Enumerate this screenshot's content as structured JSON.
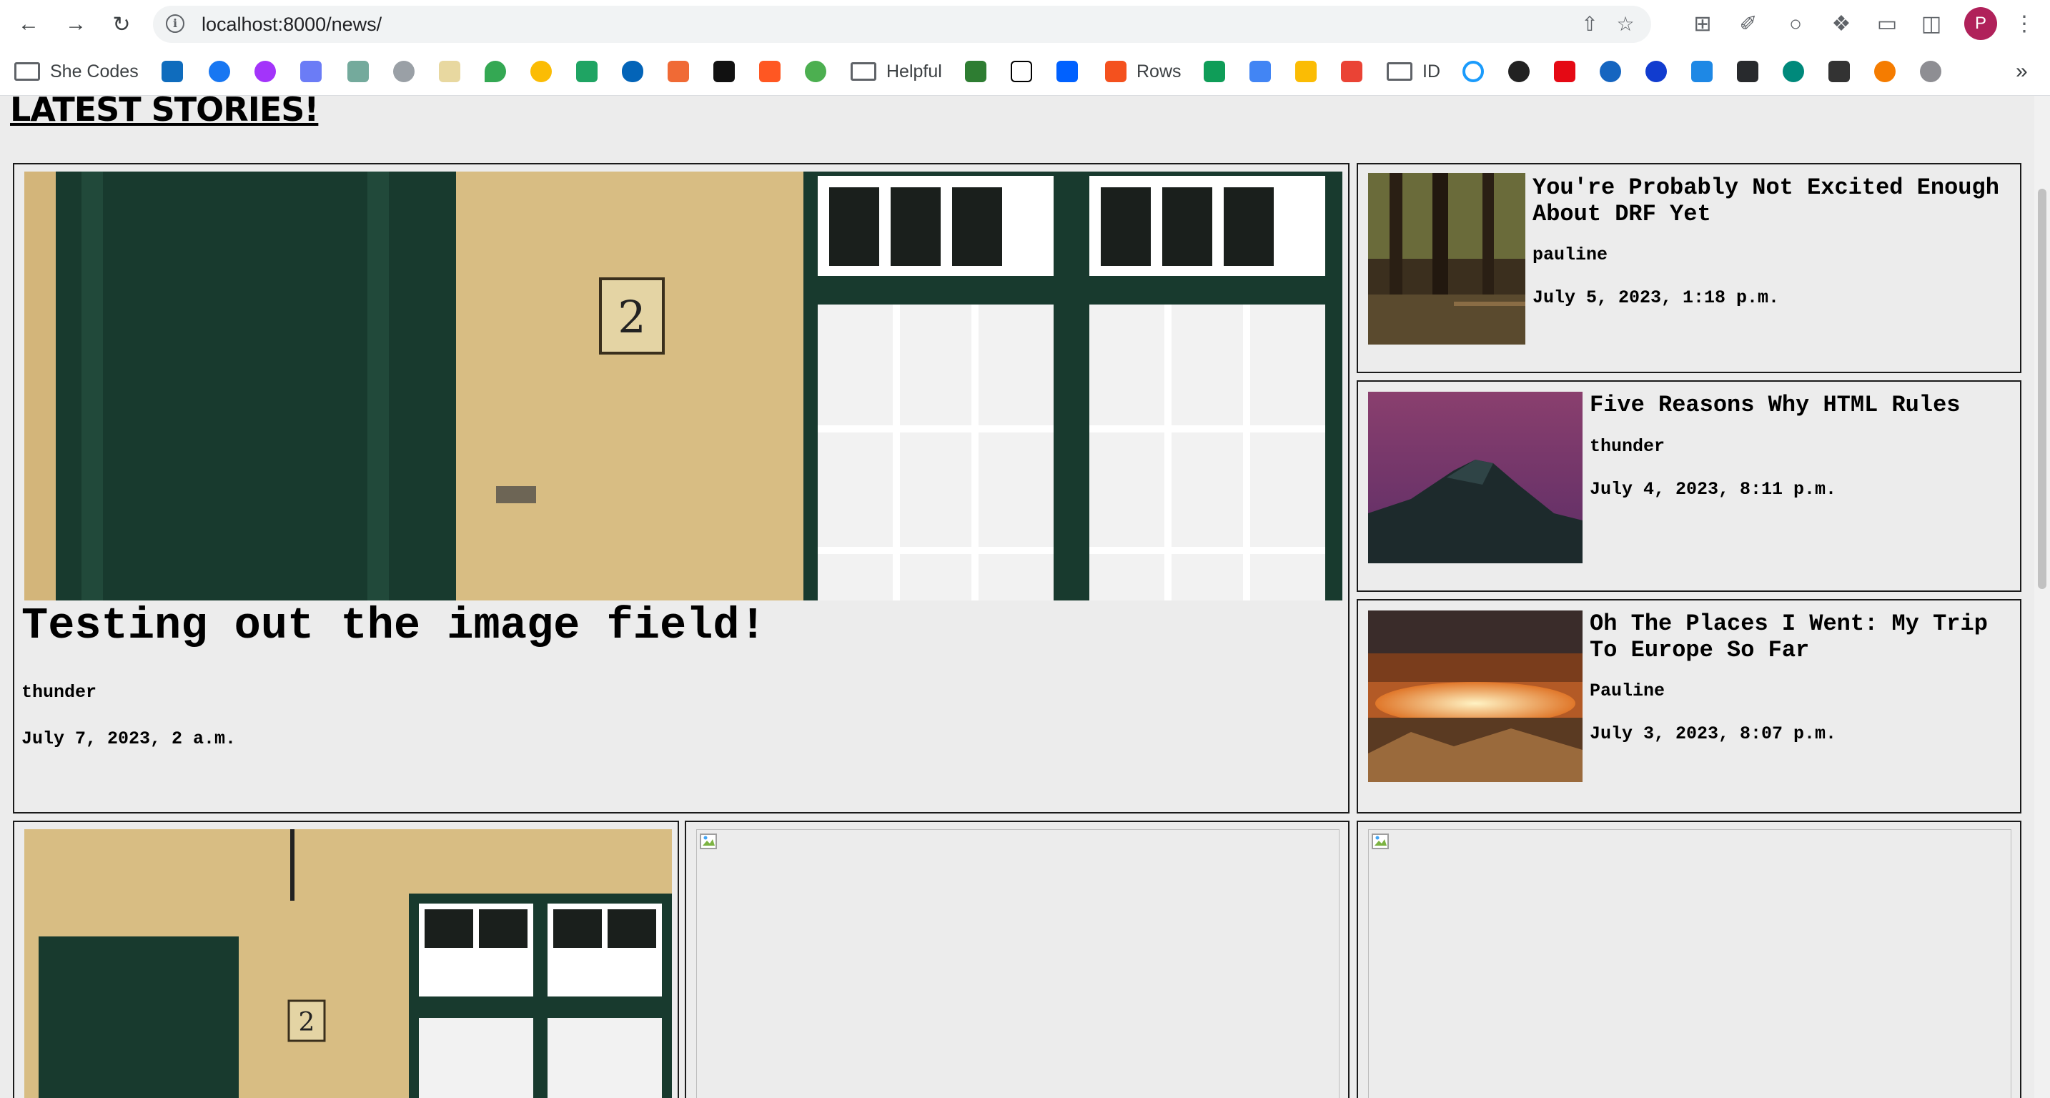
{
  "browser": {
    "url": "localhost:8000/news/",
    "profile_initial": "P",
    "bookmarks": [
      {
        "label": "She Codes"
      },
      {
        "label": "Helpful"
      },
      {
        "label": "Rows"
      },
      {
        "label": "ID"
      }
    ],
    "more_bookmarks": "»"
  },
  "page": {
    "heading": "LATEST STORIES!",
    "featured": {
      "title": "Testing out the image field!",
      "author": "thunder",
      "date": "July 7, 2023, 2 a.m."
    },
    "side_stories": [
      {
        "title": "You're Probably Not Excited Enough About DRF Yet",
        "author": "pauline",
        "date": "July 5, 2023, 1:18 p.m."
      },
      {
        "title": "Five Reasons Why HTML Rules",
        "author": "thunder",
        "date": "July 4, 2023, 8:11 p.m."
      },
      {
        "title": "Oh The Places I Went: My Trip To Europe So Far",
        "author": "Pauline",
        "date": "July 3, 2023, 8:07 p.m."
      }
    ]
  },
  "colors": {
    "page_bg": "#ececec",
    "profile": "#b0215a"
  }
}
